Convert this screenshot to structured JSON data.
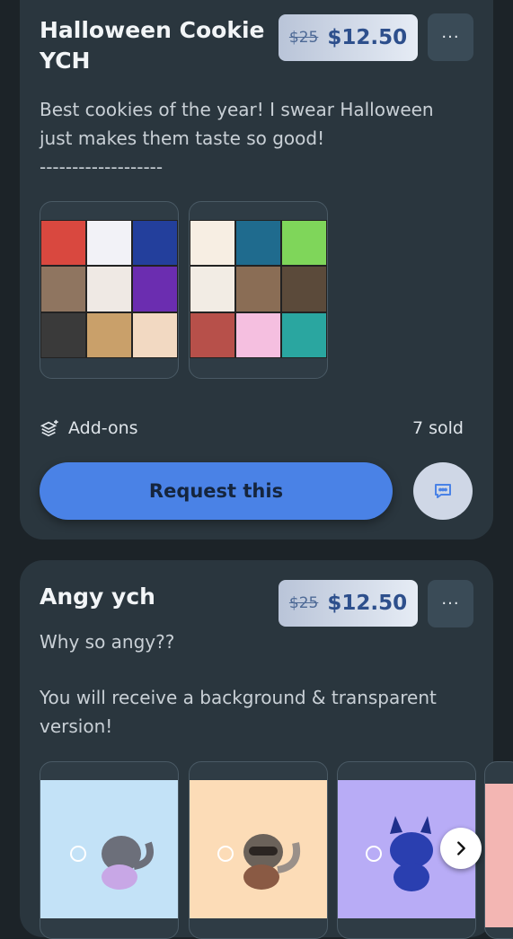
{
  "listings": [
    {
      "title": "Halloween Cookie YCH",
      "old_price": "$25",
      "new_price": "$12.50",
      "more_label": "···",
      "description": [
        "Best cookies of the year! I swear Halloween",
        "just makes them taste so good!",
        "-------------------"
      ],
      "addons_label": "Add-ons",
      "sold_label": "7 sold",
      "request_label": "Request this",
      "thumbnails": 2
    },
    {
      "title": "Angy ych",
      "old_price": "$25",
      "new_price": "$12.50",
      "more_label": "···",
      "description": [
        "Why so angy??",
        "",
        "You will receive a background & transparent",
        "version!"
      ],
      "thumbnails": 3,
      "thumb_colors": [
        "#c3e2f7",
        "#fcdcb7",
        "#b8acf6"
      ]
    }
  ],
  "colors": {
    "page_bg": "#1c2328",
    "card_bg": "#2a363e",
    "accent": "#4a82e6"
  }
}
